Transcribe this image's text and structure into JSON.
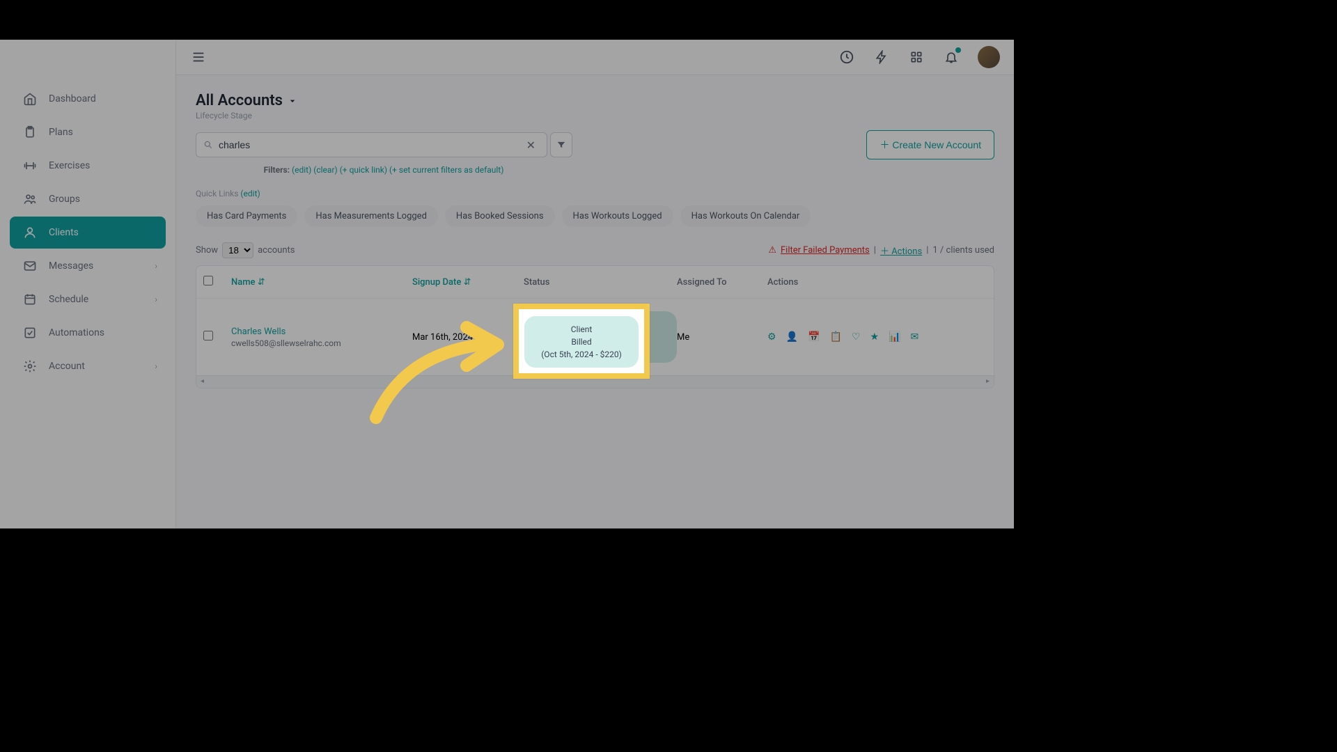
{
  "sidebar": {
    "items": [
      {
        "label": "Dashboard",
        "icon": "home"
      },
      {
        "label": "Plans",
        "icon": "clipboard"
      },
      {
        "label": "Exercises",
        "icon": "dumbbell"
      },
      {
        "label": "Groups",
        "icon": "users"
      },
      {
        "label": "Clients",
        "icon": "person",
        "active": true
      },
      {
        "label": "Messages",
        "icon": "mail",
        "chevron": true
      },
      {
        "label": "Schedule",
        "icon": "calendar",
        "chevron": true
      },
      {
        "label": "Automations",
        "icon": "check"
      },
      {
        "label": "Account",
        "icon": "gear",
        "chevron": true
      }
    ]
  },
  "page": {
    "title": "All Accounts",
    "subtitle": "Lifecycle Stage"
  },
  "search": {
    "value": "charles",
    "create_label": "Create New Account"
  },
  "filters": {
    "label": "Filters:",
    "edit": "(edit)",
    "clear": "(clear)",
    "quick_link": "(+ quick link)",
    "set_default": "(+ set current filters as default)"
  },
  "quick": {
    "label": "Quick Links",
    "edit": "(edit)",
    "chips": [
      "Has Card Payments",
      "Has Measurements Logged",
      "Has Booked Sessions",
      "Has Workouts Logged",
      "Has Workouts On Calendar"
    ]
  },
  "controls": {
    "show": "Show",
    "count": "18",
    "accounts": "accounts",
    "failed": "Filter Failed Payments",
    "actions": "Actions",
    "usage": "1 / clients used"
  },
  "table": {
    "headers": {
      "name": "Name",
      "signup": "Signup Date",
      "status": "Status",
      "assigned": "Assigned To",
      "actions": "Actions"
    },
    "row": {
      "name": "Charles Wells",
      "email": "cwells508@sllewselrahc.com",
      "signup": "Mar 16th, 2024",
      "status_line1": "Client",
      "status_line2": "Billed",
      "status_line3": "(Oct 5th, 2024 - $220)",
      "assigned": "Me"
    }
  },
  "highlight": {
    "line1": "Client",
    "line2": "Billed",
    "line3": "(Oct 5th, 2024 - $220)"
  }
}
